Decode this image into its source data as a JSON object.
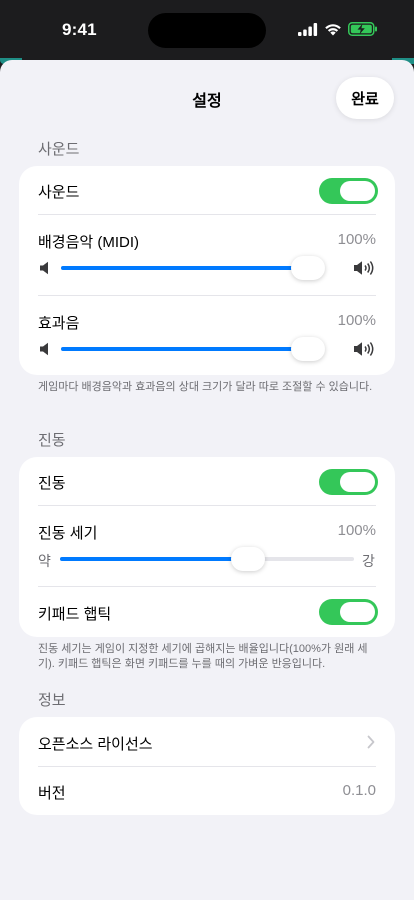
{
  "status_bar": {
    "time": "9:41"
  },
  "nav": {
    "title": "설정",
    "done_label": "완료"
  },
  "sound": {
    "header": "사운드",
    "toggle_label": "사운드",
    "toggle_on": true,
    "bgm_label": "배경음악 (MIDI)",
    "bgm_value": "100%",
    "bgm_level": 1.0,
    "sfx_label": "효과음",
    "sfx_value": "100%",
    "sfx_level": 1.0,
    "note": "게임마다 배경음악과 효과음의 상대 크기가 달라 따로 조절할 수 있습니다."
  },
  "vibration": {
    "header": "진동",
    "toggle_label": "진동",
    "toggle_on": true,
    "strength_label": "진동 세기",
    "strength_value": "100%",
    "strength_level": 0.64,
    "weak_label": "약",
    "strong_label": "강",
    "haptic_label": "키패드 햅틱",
    "haptic_on": true,
    "note": "진동 세기는 게임이 지정한 세기에 곱해지는 배율입니다(100%가 원래 세기). 키패드 햅틱은 화면 키패드를 누를 때의 가벼운 반응입니다."
  },
  "info": {
    "header": "정보",
    "license_label": "오픈소스 라이선스",
    "version_label": "버전",
    "version_value": "0.1.0"
  },
  "colors": {
    "accent": "#007aff",
    "toggle_on": "#34c759",
    "background": "#f2f2f7"
  }
}
